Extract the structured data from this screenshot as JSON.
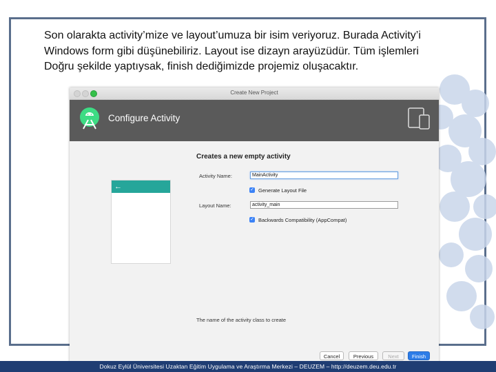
{
  "slide": {
    "text_lines": [
      "Son olarakta activity’mize ve layout’umuza bir isim veriyoruz. Burada Activity’i",
      "Windows form gibi düşünebiliriz. Layout ise dizayn arayüzüdür. Tüm işlemleri",
      "Doğru şekilde yaptıysak, finish dediğimizde projemiz oluşacaktır."
    ],
    "footer": "Dokuz Eylül Üniversitesi Uzaktan Eğitim Uygulama ve Araştırma Merkezi – DEUZEM – http://deuzem.deu.edu.tr"
  },
  "window": {
    "title": "Create New Project",
    "header_title": "Configure Activity",
    "section_title": "Creates a new empty activity",
    "activity_name_label": "Activity Name:",
    "activity_name_value": "MainActivity",
    "generate_layout_label": "Generate Layout File",
    "generate_layout_checked": true,
    "layout_name_label": "Layout Name:",
    "layout_name_value": "activity_main",
    "backwards_compat_label": "Backwards Compatibility (AppCompat)",
    "backwards_compat_checked": true,
    "help_text": "The name of the activity class to create",
    "buttons": {
      "cancel": "Cancel",
      "previous": "Previous",
      "next": "Next",
      "finish": "Finish"
    },
    "preview_arrow": "←"
  },
  "colors": {
    "header_bg": "#5a5a5a",
    "preview_bar": "#26a69a",
    "finish_button": "#2d7de8",
    "footer_bar": "#1f3d73",
    "android_green": "#3ddc84"
  }
}
